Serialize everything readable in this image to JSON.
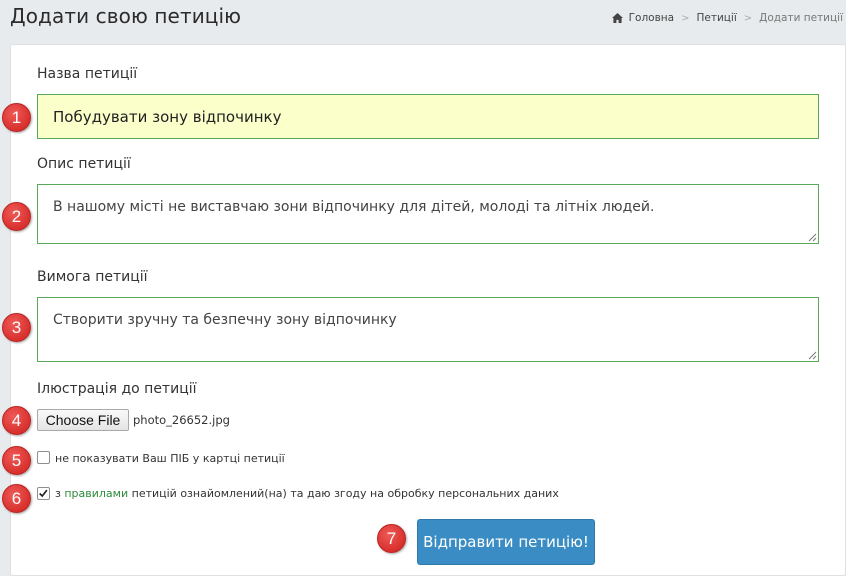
{
  "header": {
    "title": "Додати свою петицію",
    "breadcrumb": [
      "Головна",
      "Петиції",
      "Додати петиції"
    ]
  },
  "form": {
    "name_label": "Назва петиції",
    "name_value": "Побудувати зону відпочинку",
    "description_label": "Опис петиції",
    "description_value": "В нашому місті не виставчаю зони відпочинку для дітей, молоді та літніх людей.",
    "demand_label": "Вимога петиції",
    "demand_value": "Створити зручну та безпечну зону відпочинку",
    "illustration_label": "Ілюстрація до петиції",
    "file_button": "Choose File",
    "file_name": "photo_26652.jpg",
    "hide_name_label": "не показувати Ваш ПІБ у картці петиції",
    "agree_prefix": "з",
    "agree_link": "правилами",
    "agree_suffix": "петицій ознайомлений(на) та даю згоду на обробку персональних даних",
    "hide_name_checked": false,
    "agree_checked": true,
    "submit_label": "Відправити петицію!"
  },
  "badges": [
    "1",
    "2",
    "3",
    "4",
    "5",
    "6",
    "7"
  ],
  "colors": {
    "accent": "#3a8dc4",
    "badge": "#d8302d",
    "field_border": "#5aa85a",
    "highlight": "#fbffc9",
    "link": "#2e8b3a"
  }
}
